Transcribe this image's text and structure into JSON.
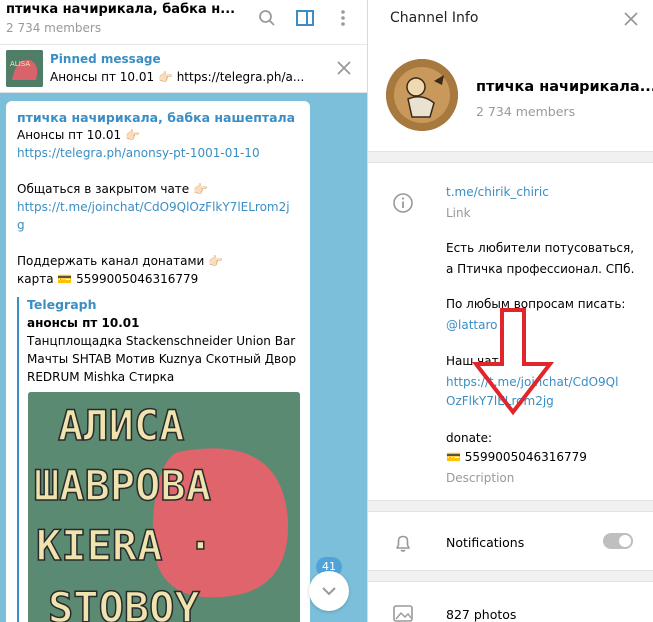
{
  "chat": {
    "title": "птичка начирикала, бабка н...",
    "members": "2 734 members",
    "pinned": {
      "label": "Pinned message",
      "text": "Анонсы пт 10.01 👉🏻 https://telegra.ph/a..."
    },
    "message": {
      "author": "птичка начирикала, бабка нашептала",
      "line1": "Анонсы пт 10.01 👉🏻",
      "link1": "https://telegra.ph/anonsy-pt-1001-01-10",
      "line2": "Общаться в закрытом чате 👉🏻",
      "link2a": "https://t.me/joinchat/CdO9QlOzFlkY7lELrom2j",
      "link2b": "g",
      "line3": "Поддержать канал донатами 👉🏻",
      "line4": "карта 💳 5599005046316779",
      "preview": {
        "site": "Telegraph",
        "title": "анонсы пт 10.01",
        "desc1": "Танцплощадка Stackenschneider Union Bar",
        "desc2": "Мачты SHTAB Мотив Kuznya Скотный Двор",
        "desc3": "REDRUM Mishka Стирка",
        "poster_lines": [
          "АЛИСА",
          "ШАВРОВА",
          "KIERA ·",
          "STOBOY"
        ]
      }
    },
    "unread_badge": "41"
  },
  "info": {
    "header": "Channel Info",
    "name": "птичка начирикала...",
    "members": "2 734 members",
    "link": "t.me/chirik_chiric",
    "link_caption": "Link",
    "desc": {
      "l1": "Есть любители потусоваться,",
      "l2": "а Птичка профессионал. СПб.",
      "l3": "По любым вопросам писать:",
      "l4": "@lattaro",
      "l5": "Наш чат:",
      "l6": "https://t.me/joinchat/CdO9Ql",
      "l7": "OzFlkY7lELrom2jg",
      "l8": "donate:",
      "l9": "💳 5599005046316779"
    },
    "desc_caption": "Description",
    "notifications": "Notifications",
    "notifications_on": false,
    "photos": "827 photos"
  },
  "colors": {
    "accent": "#3a8ec5",
    "chat_bg": "#7bbfdb",
    "arrow": "#e0262b"
  }
}
